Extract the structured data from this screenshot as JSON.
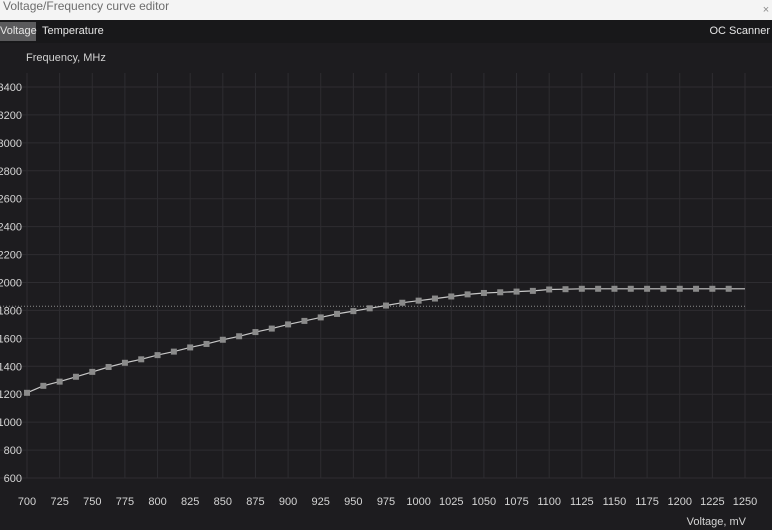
{
  "window": {
    "title": "Voltage/Frequency curve editor",
    "close_glyph": "×"
  },
  "tabs": {
    "voltage": "Voltage",
    "temperature": "Temperature",
    "oc_scanner": "OC Scanner"
  },
  "chart_data": {
    "type": "line",
    "ylabel": "Frequency, MHz",
    "xlabel": "Voltage, mV",
    "xlim": [
      700,
      1250
    ],
    "ylim": [
      600,
      3400
    ],
    "x_ticks": [
      700,
      725,
      750,
      775,
      800,
      825,
      850,
      875,
      900,
      925,
      950,
      975,
      1000,
      1025,
      1050,
      1075,
      1100,
      1125,
      1150,
      1175,
      1200,
      1225,
      1250
    ],
    "y_ticks": [
      600,
      800,
      1000,
      1200,
      1400,
      1600,
      1800,
      2000,
      2200,
      2400,
      2600,
      2800,
      3000,
      3200,
      3400
    ],
    "grid": true,
    "reference_line_mhz": 1830,
    "series": [
      {
        "points": [
          [
            700,
            1210
          ],
          [
            712.5,
            1260
          ],
          [
            725,
            1290
          ],
          [
            737.5,
            1325
          ],
          [
            750,
            1360
          ],
          [
            762.5,
            1395
          ],
          [
            775,
            1425
          ],
          [
            787.5,
            1450
          ],
          [
            800,
            1480
          ],
          [
            812.5,
            1505
          ],
          [
            825,
            1535
          ],
          [
            837.5,
            1560
          ],
          [
            850,
            1590
          ],
          [
            862.5,
            1615
          ],
          [
            875,
            1645
          ],
          [
            887.5,
            1670
          ],
          [
            900,
            1700
          ],
          [
            912.5,
            1725
          ],
          [
            925,
            1750
          ],
          [
            937.5,
            1775
          ],
          [
            950,
            1795
          ],
          [
            962.5,
            1815
          ],
          [
            975,
            1835
          ],
          [
            987.5,
            1855
          ],
          [
            1000,
            1870
          ],
          [
            1012.5,
            1885
          ],
          [
            1025,
            1900
          ],
          [
            1037.5,
            1915
          ],
          [
            1050,
            1925
          ],
          [
            1062.5,
            1930
          ],
          [
            1075,
            1935
          ],
          [
            1087.5,
            1940
          ],
          [
            1100,
            1950
          ],
          [
            1112.5,
            1952
          ],
          [
            1125,
            1955
          ],
          [
            1137.5,
            1955
          ],
          [
            1150,
            1955
          ],
          [
            1162.5,
            1955
          ],
          [
            1175,
            1955
          ],
          [
            1187.5,
            1955
          ],
          [
            1200,
            1955
          ],
          [
            1212.5,
            1955
          ],
          [
            1225,
            1955
          ],
          [
            1237.5,
            1955
          ],
          [
            1250,
            1955
          ]
        ]
      }
    ],
    "colors": {
      "curve": "#c8c8c8",
      "marker": "#8a8a8a",
      "grid": "#2e2d31",
      "reference": "#8c8c8c"
    }
  }
}
